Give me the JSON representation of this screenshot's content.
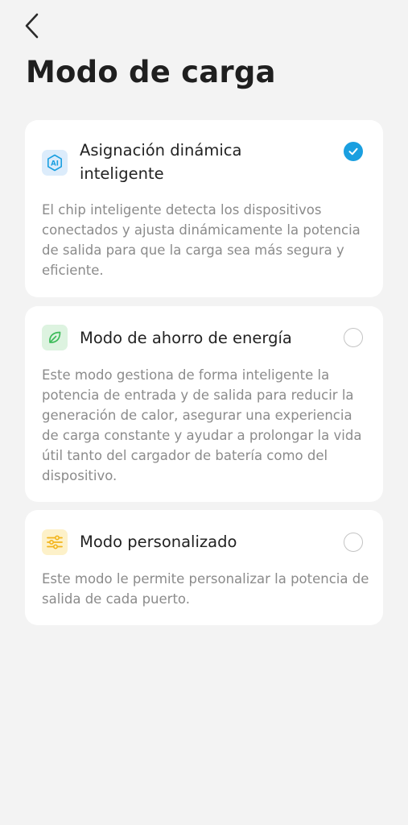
{
  "header": {
    "back_icon": "chevron-left-icon",
    "title": "Modo de carga"
  },
  "options": [
    {
      "icon": "ai-chip-icon",
      "icon_text": "AI",
      "icon_color": "#1a9fe0",
      "title": "Asignación dinámica inteligente",
      "description": "El chip inteligente detecta los dispositivos conectados y ajusta dinámicamente la potencia de salida para que la carga sea más segura y eficiente.",
      "selected": true
    },
    {
      "icon": "leaf-icon",
      "icon_color": "#3dbb5a",
      "title": "Modo de ahorro de energía",
      "description": "Este modo gestiona de forma inteligente la potencia de entrada y de salida para reducir la generación de calor, asegurar una experiencia de carga constante y ayudar a prolongar la vida útil tanto del cargador de batería como del dispositivo.",
      "selected": false
    },
    {
      "icon": "sliders-icon",
      "icon_color": "#f2b41b",
      "title": "Modo personalizado",
      "description": "Este modo le permite personalizar la potencia de salida de cada puerto.",
      "selected": false
    }
  ],
  "colors": {
    "accent": "#1a9fe0",
    "background": "#f3f3f3",
    "card": "#ffffff"
  }
}
